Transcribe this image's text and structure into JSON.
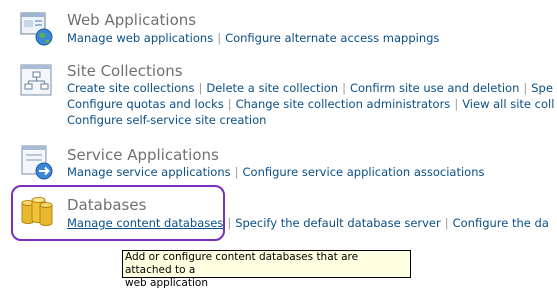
{
  "sections": {
    "web_applications": {
      "title": "Web Applications",
      "links": [
        "Manage web applications",
        "Configure alternate access mappings"
      ]
    },
    "site_collections": {
      "title": "Site Collections",
      "row1": [
        "Create site collections",
        "Delete a site collection",
        "Confirm site use and deletion",
        "Spe"
      ],
      "row2": [
        "Configure quotas and locks",
        "Change site collection administrators",
        "View all site coll"
      ],
      "row3": [
        "Configure self-service site creation"
      ]
    },
    "service_applications": {
      "title": "Service Applications",
      "links": [
        "Manage service applications",
        "Configure service application associations"
      ]
    },
    "databases": {
      "title": "Databases",
      "links": [
        "Manage content databases",
        "Specify the default database server",
        "Configure the da"
      ]
    }
  },
  "separator": "|",
  "tooltip": {
    "line1": "Add or configure content databases that are attached to a",
    "line2": "web application"
  },
  "colors": {
    "link": "#0b4f86",
    "title": "#707070",
    "highlight": "#7b2fbe",
    "tooltip_bg": "#ffffe1"
  }
}
